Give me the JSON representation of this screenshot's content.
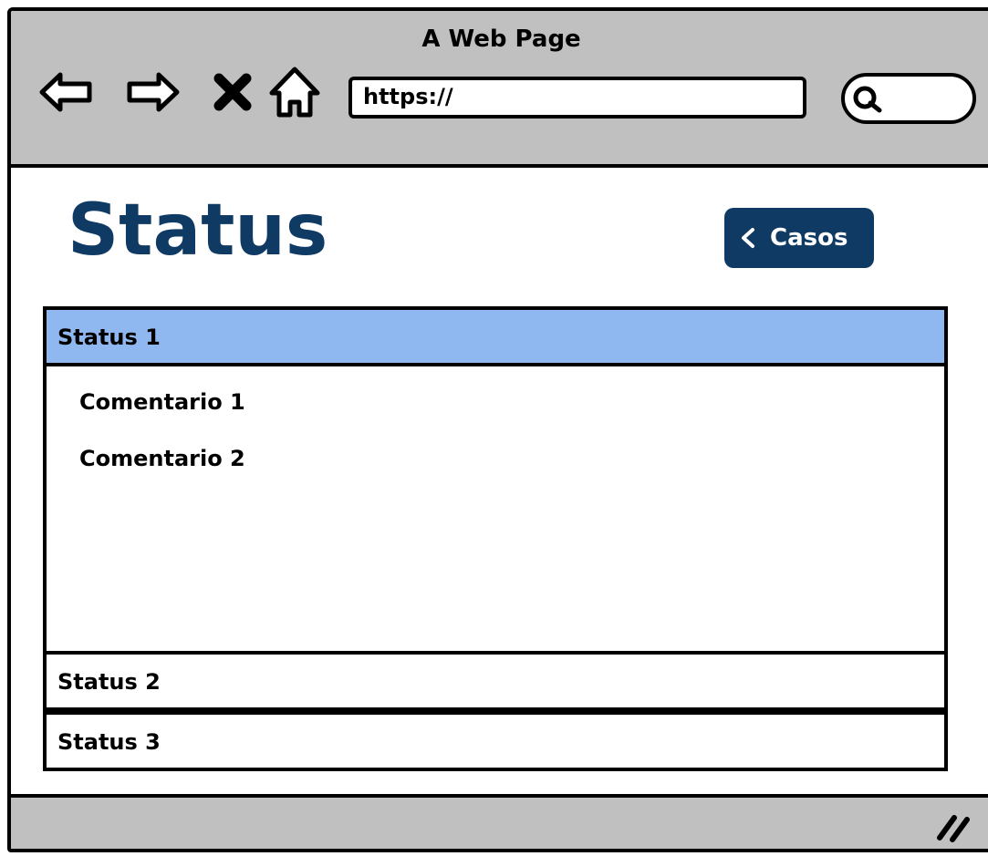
{
  "browser": {
    "window_title": "A Web Page",
    "url": "https://",
    "icons": {
      "back": "back-arrow-icon",
      "forward": "forward-arrow-icon",
      "stop": "close-icon",
      "home": "home-icon",
      "search": "search-icon",
      "grip": "resize-grip-icon"
    }
  },
  "page": {
    "title": "Status",
    "back_button_label": "Casos"
  },
  "accordion": {
    "sections": [
      {
        "label": "Status 1",
        "expanded": true,
        "items": [
          "Comentario 1",
          "Comentario 2"
        ]
      },
      {
        "label": "Status 2",
        "expanded": false
      },
      {
        "label": "Status 3",
        "expanded": false
      }
    ]
  },
  "colors": {
    "title": "#0e3a64",
    "button_bg": "#0e3a64",
    "active_header": "#90b8f0",
    "chrome": "#c0c0c0"
  }
}
